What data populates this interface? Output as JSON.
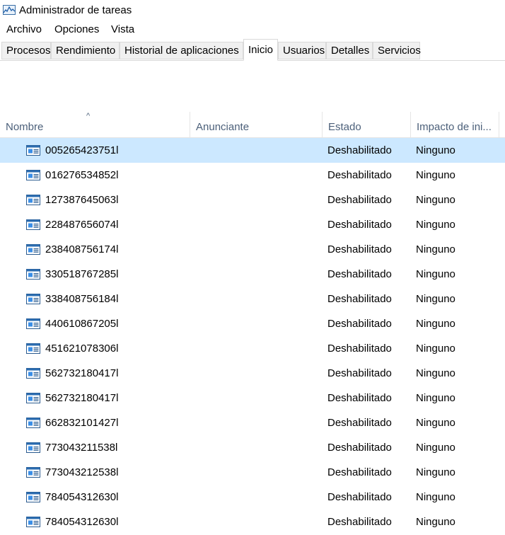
{
  "window": {
    "title": "Administrador de tareas"
  },
  "menu": [
    "Archivo",
    "Opciones",
    "Vista"
  ],
  "tabs": [
    "Procesos",
    "Rendimiento",
    "Historial de aplicaciones",
    "Inicio",
    "Usuarios",
    "Detalles",
    "Servicios"
  ],
  "active_tab": "Inicio",
  "columns": {
    "name": "Nombre",
    "publisher": "Anunciante",
    "state": "Estado",
    "impact": "Impacto de ini..."
  },
  "sort_indicator": "^",
  "rows": [
    {
      "name": "005265423751l",
      "publisher": "",
      "state": "Deshabilitado",
      "impact": "Ninguno"
    },
    {
      "name": "016276534852l",
      "publisher": "",
      "state": "Deshabilitado",
      "impact": "Ninguno"
    },
    {
      "name": "127387645063l",
      "publisher": "",
      "state": "Deshabilitado",
      "impact": "Ninguno"
    },
    {
      "name": "228487656074l",
      "publisher": "",
      "state": "Deshabilitado",
      "impact": "Ninguno"
    },
    {
      "name": "238408756174l",
      "publisher": "",
      "state": "Deshabilitado",
      "impact": "Ninguno"
    },
    {
      "name": "330518767285l",
      "publisher": "",
      "state": "Deshabilitado",
      "impact": "Ninguno"
    },
    {
      "name": "338408756184l",
      "publisher": "",
      "state": "Deshabilitado",
      "impact": "Ninguno"
    },
    {
      "name": "440610867205l",
      "publisher": "",
      "state": "Deshabilitado",
      "impact": "Ninguno"
    },
    {
      "name": "451621078306l",
      "publisher": "",
      "state": "Deshabilitado",
      "impact": "Ninguno"
    },
    {
      "name": "562732180417l",
      "publisher": "",
      "state": "Deshabilitado",
      "impact": "Ninguno"
    },
    {
      "name": "562732180417l",
      "publisher": "",
      "state": "Deshabilitado",
      "impact": "Ninguno"
    },
    {
      "name": "662832101427l",
      "publisher": "",
      "state": "Deshabilitado",
      "impact": "Ninguno"
    },
    {
      "name": "773043211538l",
      "publisher": "",
      "state": "Deshabilitado",
      "impact": "Ninguno"
    },
    {
      "name": "773043212538l",
      "publisher": "",
      "state": "Deshabilitado",
      "impact": "Ninguno"
    },
    {
      "name": "784054312630l",
      "publisher": "",
      "state": "Deshabilitado",
      "impact": "Ninguno"
    },
    {
      "name": "784054312630l",
      "publisher": "",
      "state": "Deshabilitado",
      "impact": "Ninguno"
    }
  ],
  "selected_row": 0,
  "colors": {
    "selection": "#cce8ff",
    "header_text": "#4c607a",
    "tab_bg": "#f0f0f0",
    "border": "#d9d9d9"
  },
  "icons": {
    "app": "task-manager-icon",
    "row": "application-window-icon"
  }
}
